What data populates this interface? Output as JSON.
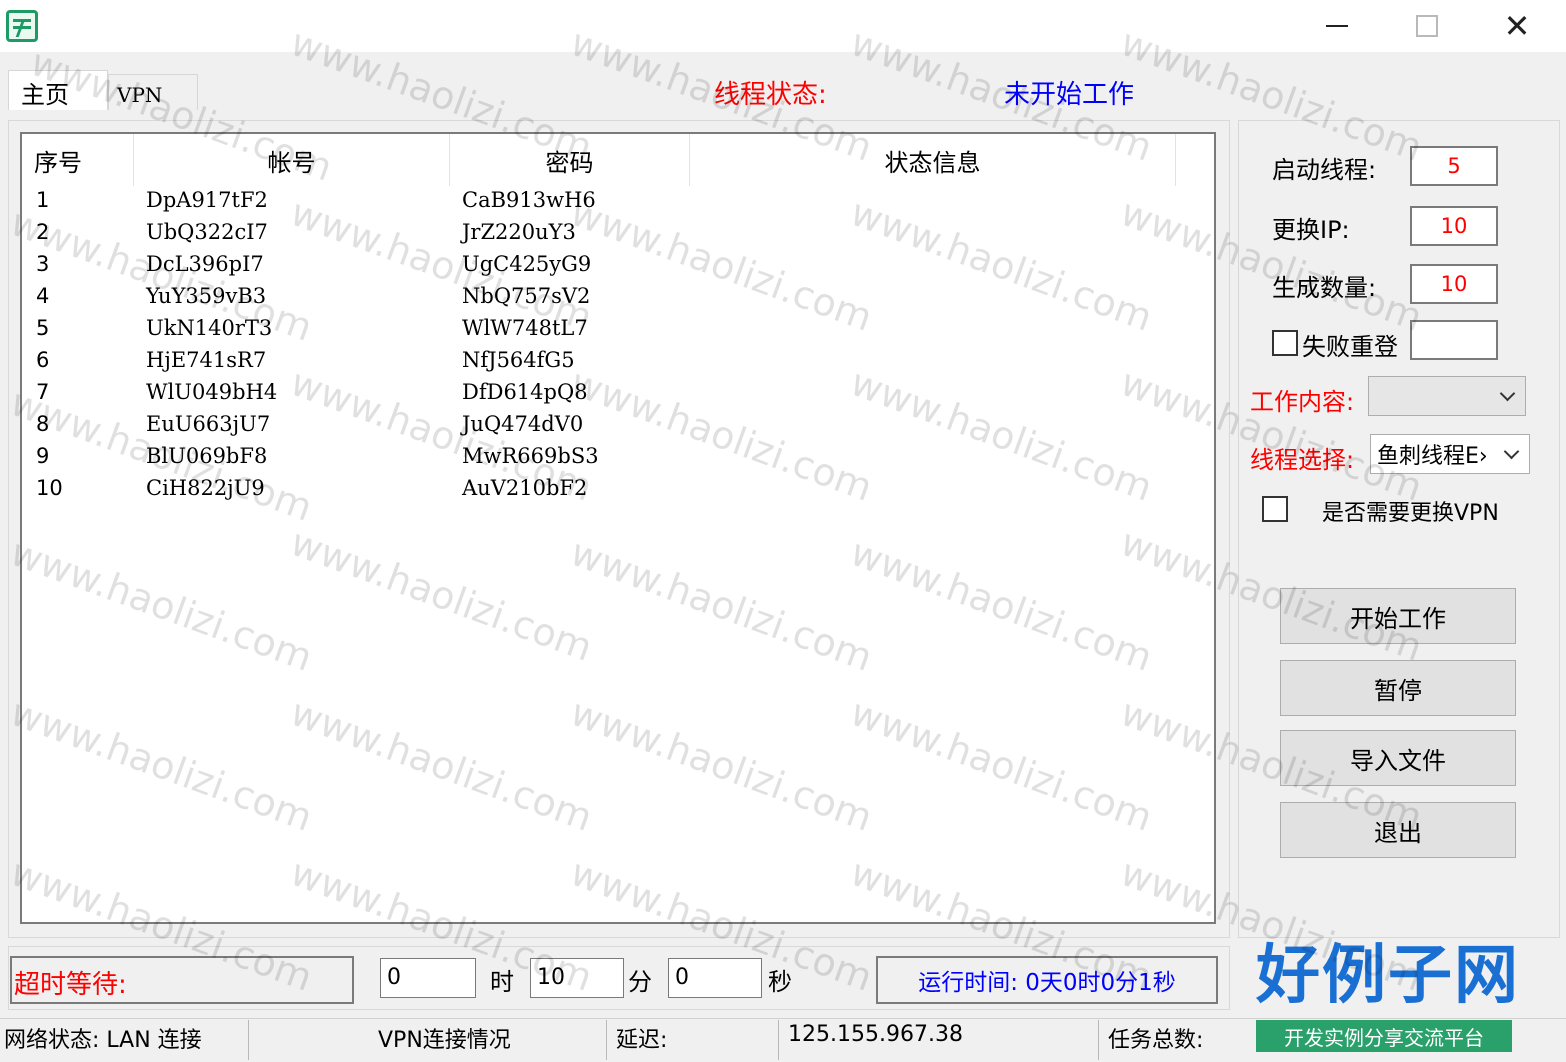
{
  "window": {
    "close_symbol": "✕"
  },
  "tabs": [
    {
      "label": "主页"
    },
    {
      "label": "VPN"
    }
  ],
  "thread_status": {
    "label": "线程状态:",
    "value": "未开始工作"
  },
  "table": {
    "headers": [
      "序号",
      "帐号",
      "密码",
      "状态信息"
    ],
    "rows": [
      [
        "1",
        "DpA917tF2",
        "CaB913wH6",
        ""
      ],
      [
        "2",
        "UbQ322cI7",
        "JrZ220uY3",
        ""
      ],
      [
        "3",
        "DcL396pI7",
        "UgC425yG9",
        ""
      ],
      [
        "4",
        "YuY359vB3",
        "NbQ757sV2",
        ""
      ],
      [
        "5",
        "UkN140rT3",
        "WlW748tL7",
        ""
      ],
      [
        "6",
        "HjE741sR7",
        "NfJ564fG5",
        ""
      ],
      [
        "7",
        "WlU049bH4",
        "DfD614pQ8",
        ""
      ],
      [
        "8",
        "EuU663jU7",
        "JuQ474dV0",
        ""
      ],
      [
        "9",
        "BlU069bF8",
        "MwR669bS3",
        ""
      ],
      [
        "10",
        "CiH822jU9",
        "AuV210bF2",
        ""
      ]
    ]
  },
  "settings": {
    "start_threads": {
      "label": "启动线程:",
      "value": "5"
    },
    "change_ip": {
      "label": "更换IP:",
      "value": "10"
    },
    "gen_count": {
      "label": "生成数量:",
      "value": "10"
    },
    "fail_relogin": {
      "label": "失败重登",
      "value": ""
    },
    "work_content": {
      "label": "工作内容:",
      "selected": ""
    },
    "thread_select": {
      "label": "线程选择:",
      "selected": "鱼刺线程E›"
    },
    "need_vpn": {
      "label": "是否需要更换VPN"
    }
  },
  "buttons": {
    "start": "开始工作",
    "pause": "暂停",
    "import": "导入文件",
    "exit": "退出"
  },
  "bottom": {
    "timeout_label": "超时等待:",
    "hours": {
      "value": "0",
      "unit": "时"
    },
    "minutes": {
      "value": "10",
      "unit": "分"
    },
    "seconds": {
      "value": "0",
      "unit": "秒"
    },
    "runtime": "运行时间: 0天0时0分1秒"
  },
  "statusbar": {
    "network": "网络状态: LAN 连接",
    "vpn": "VPN连接情况",
    "latency": "延迟:",
    "ip": "125.155.967.38",
    "total": "任务总数:"
  },
  "logo": {
    "main": "好例子网",
    "sub": "开发实例分享交流平台"
  },
  "watermark": "www.haolizi.com",
  "colors": {
    "red_text": "#ff0000",
    "blue_text": "#0000ff",
    "logo_blue": "#1a6fd3",
    "logo_green": "#2aa06b"
  }
}
